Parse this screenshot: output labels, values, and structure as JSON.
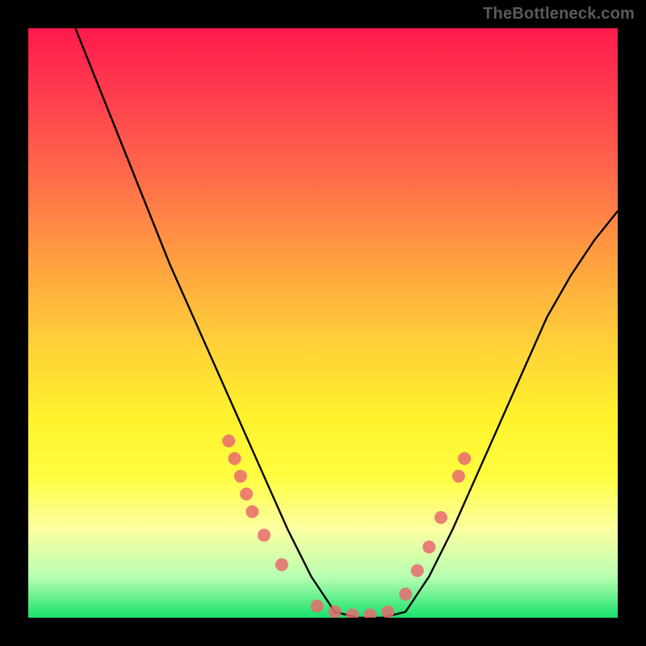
{
  "watermark": "TheBottleneck.com",
  "chart_data": {
    "type": "line",
    "title": "",
    "xlabel": "",
    "ylabel": "",
    "xlim": [
      0,
      100
    ],
    "ylim": [
      0,
      100
    ],
    "grid": false,
    "legend": false,
    "background_gradient": {
      "direction": "vertical",
      "stops": [
        {
          "pos": 0.0,
          "color": "#ff1a4c"
        },
        {
          "pos": 0.12,
          "color": "#ff3f4e"
        },
        {
          "pos": 0.26,
          "color": "#ff6e4a"
        },
        {
          "pos": 0.4,
          "color": "#ffa23f"
        },
        {
          "pos": 0.54,
          "color": "#ffd238"
        },
        {
          "pos": 0.66,
          "color": "#fff22c"
        },
        {
          "pos": 0.76,
          "color": "#fffd40"
        },
        {
          "pos": 0.85,
          "color": "#fbffa2"
        },
        {
          "pos": 0.93,
          "color": "#b8ffb0"
        },
        {
          "pos": 1.0,
          "color": "#18e26d"
        }
      ]
    },
    "series": [
      {
        "name": "bottleneck-curve",
        "color": "#000000",
        "x": [
          8,
          12,
          16,
          20,
          24,
          28,
          32,
          36,
          40,
          44,
          48,
          52,
          56,
          60,
          64,
          68,
          72,
          76,
          80,
          84,
          88,
          92,
          96,
          100
        ],
        "y": [
          100,
          90,
          80,
          70,
          60,
          51,
          42,
          33,
          24,
          15,
          7,
          1,
          0,
          0,
          1,
          7,
          15,
          24,
          33,
          42,
          51,
          58,
          64,
          69
        ]
      }
    ],
    "markers": [
      {
        "name": "left-cluster",
        "color": "#e86a6f",
        "points": [
          {
            "x": 34,
            "y": 30
          },
          {
            "x": 35,
            "y": 27
          },
          {
            "x": 36,
            "y": 24
          },
          {
            "x": 37,
            "y": 21
          },
          {
            "x": 38,
            "y": 18
          },
          {
            "x": 40,
            "y": 14
          },
          {
            "x": 43,
            "y": 9
          }
        ]
      },
      {
        "name": "trough-cluster",
        "color": "#e86a6f",
        "points": [
          {
            "x": 49,
            "y": 2
          },
          {
            "x": 52,
            "y": 1
          },
          {
            "x": 55,
            "y": 0.5
          },
          {
            "x": 58,
            "y": 0.5
          },
          {
            "x": 61,
            "y": 1
          }
        ]
      },
      {
        "name": "right-cluster",
        "color": "#e86a6f",
        "points": [
          {
            "x": 64,
            "y": 4
          },
          {
            "x": 66,
            "y": 8
          },
          {
            "x": 68,
            "y": 12
          },
          {
            "x": 70,
            "y": 17
          },
          {
            "x": 73,
            "y": 24
          },
          {
            "x": 74,
            "y": 27
          }
        ]
      }
    ]
  }
}
